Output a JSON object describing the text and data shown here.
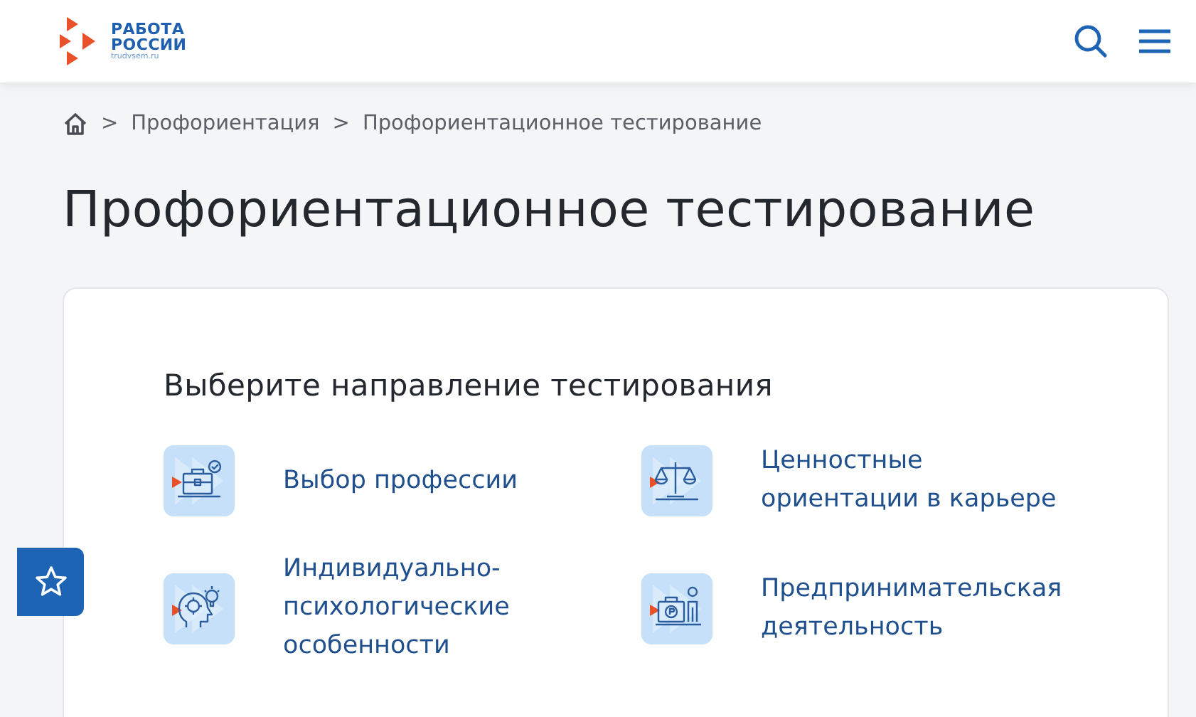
{
  "header": {
    "logo": {
      "line_1": "РАБОТА",
      "line_2": "РОССИИ",
      "site": "trudvsem.ru"
    }
  },
  "breadcrumbs": {
    "separator": ">",
    "items": [
      "Профориентация",
      "Профориентационное тестирование"
    ]
  },
  "title": "Профориентационное тестирование",
  "card": {
    "heading": "Выберите направление тестирования",
    "options": [
      {
        "label": "Выбор профессии",
        "kind": "briefcase"
      },
      {
        "label": "Ценностные ориентации в карьере",
        "kind": "scales"
      },
      {
        "label": "Индивидуально-психологические особенности",
        "kind": "head"
      },
      {
        "label": "Предпринимательская деятельность",
        "kind": "business"
      }
    ]
  }
}
